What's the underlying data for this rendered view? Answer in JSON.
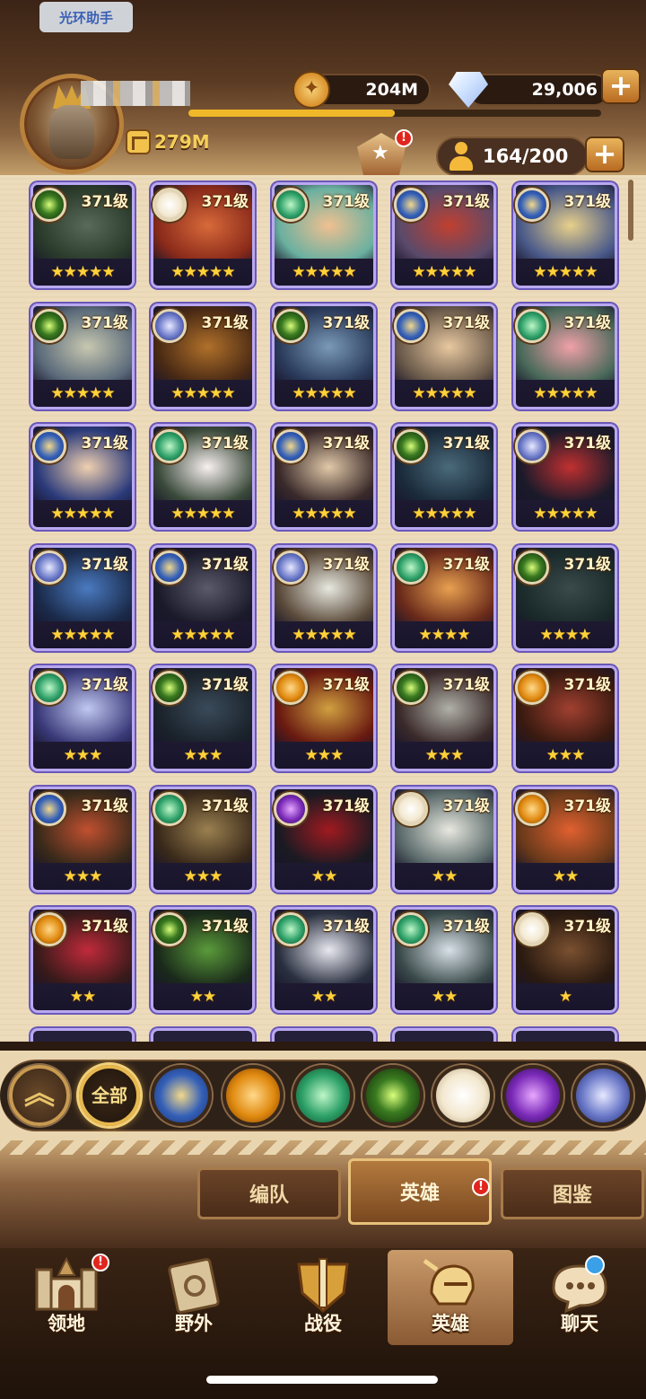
{
  "overlay_label": "光环助手",
  "player": {
    "power": "279M",
    "xp_fraction": 0.5
  },
  "resources": {
    "gold": "204M",
    "diamonds": "29,006"
  },
  "hero_count": "164/200",
  "heroes": [
    {
      "level": "371级",
      "faction": "graveborn",
      "stars": "★★★★★",
      "colors": [
        "#5a6a5a",
        "#2a3a2a"
      ]
    },
    {
      "level": "371级",
      "faction": "celestial",
      "stars": "★★★★★",
      "colors": [
        "#d86a3a",
        "#8a2a1a"
      ]
    },
    {
      "level": "371级",
      "faction": "wilder",
      "stars": "★★★★★",
      "colors": [
        "#f0c090",
        "#6ab0a0"
      ]
    },
    {
      "level": "371级",
      "faction": "lightbearer",
      "stars": "★★★★★",
      "colors": [
        "#c04030",
        "#5a4a6a"
      ]
    },
    {
      "level": "371级",
      "faction": "lightbearer",
      "stars": "★★★★★",
      "colors": [
        "#e8d08a",
        "#4a5a8a"
      ]
    },
    {
      "level": "371级",
      "faction": "graveborn",
      "stars": "★★★★★",
      "colors": [
        "#c8c8b0",
        "#5a6a7a"
      ]
    },
    {
      "level": "371级",
      "faction": "dimensional",
      "stars": "★★★★★",
      "colors": [
        "#b0702a",
        "#4a2a14"
      ]
    },
    {
      "level": "371级",
      "faction": "graveborn",
      "stars": "★★★★★",
      "colors": [
        "#7a9ab8",
        "#2a3a5a"
      ]
    },
    {
      "level": "371级",
      "faction": "lightbearer",
      "stars": "★★★★★",
      "colors": [
        "#e8c8a0",
        "#6a5a4a"
      ]
    },
    {
      "level": "371级",
      "faction": "wilder",
      "stars": "★★★★★",
      "colors": [
        "#f0a0a8",
        "#4a6a5a"
      ]
    },
    {
      "level": "371级",
      "faction": "lightbearer",
      "stars": "★★★★★",
      "colors": [
        "#f0d0b0",
        "#2a3a7a"
      ]
    },
    {
      "level": "371级",
      "faction": "wilder",
      "stars": "★★★★★",
      "colors": [
        "#f8f0f0",
        "#3a4a3a"
      ]
    },
    {
      "level": "371级",
      "faction": "lightbearer",
      "stars": "★★★★★",
      "colors": [
        "#e0c8a8",
        "#3a2a2a"
      ]
    },
    {
      "level": "371级",
      "faction": "graveborn",
      "stars": "★★★★★",
      "colors": [
        "#4a6a7a",
        "#1a2a3a"
      ]
    },
    {
      "level": "371级",
      "faction": "dimensional",
      "stars": "★★★★★",
      "colors": [
        "#c03030",
        "#1a1a2a"
      ]
    },
    {
      "level": "371级",
      "faction": "dimensional",
      "stars": "★★★★★",
      "colors": [
        "#4a7ac0",
        "#1a2a4a"
      ]
    },
    {
      "level": "371级",
      "faction": "lightbearer",
      "stars": "★★★★★",
      "colors": [
        "#5a5a6a",
        "#1a1a2a"
      ]
    },
    {
      "level": "371级",
      "faction": "dimensional",
      "stars": "★★★★★",
      "colors": [
        "#e8e8e0",
        "#5a4a3a"
      ]
    },
    {
      "level": "371级",
      "faction": "wilder",
      "stars": "★★★★",
      "colors": [
        "#e8a050",
        "#6a2a1a"
      ]
    },
    {
      "level": "371级",
      "faction": "graveborn",
      "stars": "★★★★",
      "colors": [
        "#3a4a4a",
        "#1a2a2a"
      ]
    },
    {
      "level": "371级",
      "faction": "wilder",
      "stars": "★★★",
      "colors": [
        "#c0c8f0",
        "#3a3a7a"
      ]
    },
    {
      "level": "371级",
      "faction": "graveborn",
      "stars": "★★★",
      "colors": [
        "#3a4a5a",
        "#1a222a"
      ]
    },
    {
      "level": "371级",
      "faction": "mauler",
      "stars": "★★★",
      "colors": [
        "#d0a040",
        "#6a1a10"
      ]
    },
    {
      "level": "371级",
      "faction": "graveborn",
      "stars": "★★★",
      "colors": [
        "#b0b0a8",
        "#3a2a2a"
      ]
    },
    {
      "level": "371级",
      "faction": "mauler",
      "stars": "★★★",
      "colors": [
        "#a04030",
        "#3a1a10"
      ]
    },
    {
      "level": "371级",
      "faction": "lightbearer",
      "stars": "★★★",
      "colors": [
        "#c05030",
        "#3a2a1a"
      ]
    },
    {
      "level": "371级",
      "faction": "wilder",
      "stars": "★★★",
      "colors": [
        "#9a8050",
        "#3a2a1a"
      ]
    },
    {
      "level": "371级",
      "faction": "hypogean",
      "stars": "★★",
      "colors": [
        "#a01a20",
        "#1a1a22"
      ]
    },
    {
      "level": "371级",
      "faction": "celestial",
      "stars": "★★",
      "colors": [
        "#e8e8e0",
        "#5a6a6a"
      ]
    },
    {
      "level": "371级",
      "faction": "mauler",
      "stars": "★★",
      "colors": [
        "#e06030",
        "#6a3a1a"
      ]
    },
    {
      "level": "371级",
      "faction": "mauler",
      "stars": "★★",
      "colors": [
        "#c02a3a",
        "#3a1a1a"
      ]
    },
    {
      "level": "371级",
      "faction": "graveborn",
      "stars": "★★",
      "colors": [
        "#5a9a3a",
        "#1a2a1a"
      ]
    },
    {
      "level": "371级",
      "faction": "wilder",
      "stars": "★★",
      "colors": [
        "#e8e8f0",
        "#2a3040"
      ]
    },
    {
      "level": "371级",
      "faction": "wilder",
      "stars": "★★",
      "colors": [
        "#d8e0e8",
        "#3a4a4a"
      ]
    },
    {
      "level": "371级",
      "faction": "celestial",
      "stars": "★",
      "colors": [
        "#7a5030",
        "#2a1a10"
      ]
    }
  ],
  "filters": [
    {
      "name": "collapse",
      "label": "︽"
    },
    {
      "name": "all",
      "label": "全部"
    },
    {
      "name": "lightbearer",
      "label": ""
    },
    {
      "name": "mauler",
      "label": ""
    },
    {
      "name": "wilder",
      "label": ""
    },
    {
      "name": "graveborn",
      "label": ""
    },
    {
      "name": "celestial",
      "label": ""
    },
    {
      "name": "hypogean",
      "label": ""
    },
    {
      "name": "dimensional",
      "label": ""
    }
  ],
  "subtabs": {
    "formation": "编队",
    "heroes": "英雄",
    "codex": "图鉴"
  },
  "nav": {
    "territory": "领地",
    "wilds": "野外",
    "campaign": "战役",
    "heroes": "英雄",
    "chat": "聊天"
  },
  "badge_mark": "!"
}
